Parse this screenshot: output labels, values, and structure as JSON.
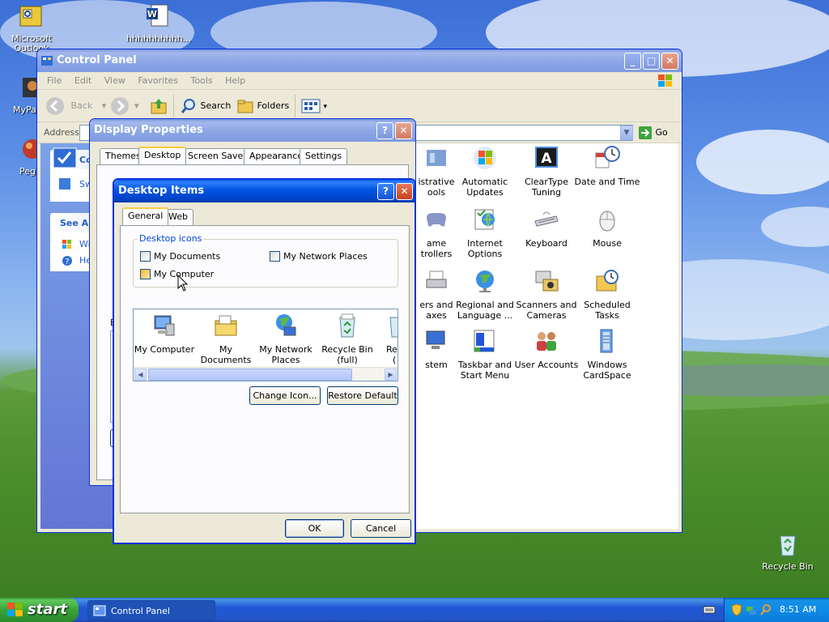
{
  "desktop": {
    "icons": [
      {
        "label": "Microsoft Outlook",
        "icon": "outlook-icon"
      },
      {
        "label": "hhhhhhhhhh...",
        "icon": "word-document-icon"
      },
      {
        "label": "MyPa",
        "icon": "shortcut-icon"
      },
      {
        "label": "Peg",
        "icon": "pegasus-icon"
      },
      {
        "label": "Recycle Bin",
        "icon": "recycle-bin-icon"
      }
    ]
  },
  "control_panel": {
    "title": "Control Panel",
    "menu": [
      "File",
      "Edit",
      "View",
      "Favorites",
      "Tools",
      "Help"
    ],
    "toolbar": {
      "back": "Back",
      "search": "Search",
      "folders": "Folders"
    },
    "address_label": "Address",
    "go_label": "Go",
    "sidebar": {
      "panel_title": "Con",
      "switch_text": "Sw",
      "see_also": "See Als",
      "links": [
        "Wi",
        "He"
      ]
    },
    "items": [
      {
        "line1": "istrative",
        "line2": "ools",
        "icon": "admin-tools-icon"
      },
      {
        "line1": "Automatic",
        "line2": "Updates",
        "icon": "windows-update-icon"
      },
      {
        "line1": "ClearType",
        "line2": "Tuning",
        "icon": "cleartype-icon"
      },
      {
        "line1": "Date and Time",
        "line2": "",
        "icon": "clock-icon"
      },
      {
        "line1": "ame",
        "line2": "trollers",
        "icon": "game-controller-icon"
      },
      {
        "line1": "Internet",
        "line2": "Options",
        "icon": "internet-options-icon"
      },
      {
        "line1": "Keyboard",
        "line2": "",
        "icon": "keyboard-icon"
      },
      {
        "line1": "Mouse",
        "line2": "",
        "icon": "mouse-icon"
      },
      {
        "line1": "ers and",
        "line2": "axes",
        "icon": "printer-icon"
      },
      {
        "line1": "Regional and",
        "line2": "Language ...",
        "icon": "globe-icon"
      },
      {
        "line1": "Scanners and",
        "line2": "Cameras",
        "icon": "scanner-icon"
      },
      {
        "line1": "Scheduled",
        "line2": "Tasks",
        "icon": "scheduled-tasks-icon"
      },
      {
        "line1": "stem",
        "line2": "",
        "icon": "system-icon"
      },
      {
        "line1": "Taskbar and",
        "line2": "Start Menu",
        "icon": "taskbar-icon"
      },
      {
        "line1": "User Accounts",
        "line2": "",
        "icon": "users-icon"
      },
      {
        "line1": "Windows",
        "line2": "CardSpace",
        "icon": "cardspace-icon"
      }
    ]
  },
  "display_properties": {
    "title": "Display Properties",
    "tabs": [
      "Themes",
      "Desktop",
      "Screen Saver",
      "Appearance",
      "Settings"
    ],
    "active_tab": "Desktop",
    "partial_label": "B"
  },
  "desktop_items": {
    "title": "Desktop Items",
    "tabs": [
      "General",
      "Web"
    ],
    "group_label": "Desktop icons",
    "checkboxes": [
      {
        "label": "My Documents",
        "checked": false
      },
      {
        "label": "My Network Places",
        "checked": false
      },
      {
        "label": "My Computer",
        "checked": false
      }
    ],
    "icons": [
      {
        "line1": "My Computer",
        "line2": "",
        "icon": "my-computer-icon"
      },
      {
        "line1": "My Documents",
        "line2": "",
        "icon": "my-documents-icon"
      },
      {
        "line1": "My Network",
        "line2": "Places",
        "icon": "network-places-icon"
      },
      {
        "line1": "Recycle Bin",
        "line2": "(full)",
        "icon": "recycle-bin-full-icon"
      },
      {
        "line1": "Re",
        "line2": "(",
        "icon": "recycle-bin-empty-icon"
      }
    ],
    "change_icon": "Change Icon...",
    "restore_default": "Restore Default",
    "ok": "OK",
    "cancel": "Cancel"
  },
  "taskbar": {
    "start": "start",
    "task_label": "Control Panel",
    "clock": "8:51 AM"
  }
}
